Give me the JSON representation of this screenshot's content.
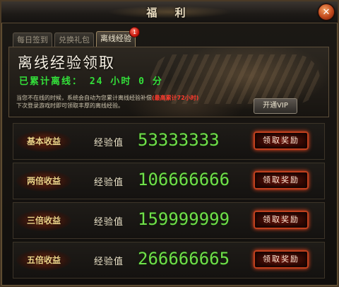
{
  "window": {
    "title": "福 利",
    "close_glyph": "✕"
  },
  "tabs": [
    {
      "label": "每日签到"
    },
    {
      "label": "兑换礼包"
    },
    {
      "label": "离线经验",
      "badge": "1"
    }
  ],
  "banner": {
    "title": "离线经验领取",
    "offline_prefix": "已累计离线：",
    "hours": "24",
    "hours_unit": "小时",
    "minutes": "0",
    "minutes_unit": "分",
    "desc_line1": "当您不在线的时候，系统会自动为您累计离线经验补偿",
    "desc_limit": "(最高累计72小时)",
    "desc_line2": "下次登录游戏时即可领取丰厚的离线经验。",
    "vip_button": "开通VIP"
  },
  "rewards": [
    {
      "label": "基本收益",
      "exp_label": "经验值",
      "value": "53333333",
      "button": "领取奖励"
    },
    {
      "label": "两倍收益",
      "exp_label": "经验值",
      "value": "106666666",
      "button": "领取奖励"
    },
    {
      "label": "三倍收益",
      "exp_label": "经验值",
      "value": "159999999",
      "button": "领取奖励"
    },
    {
      "label": "五倍收益",
      "exp_label": "经验值",
      "value": "266666665",
      "button": "领取奖励"
    }
  ]
}
